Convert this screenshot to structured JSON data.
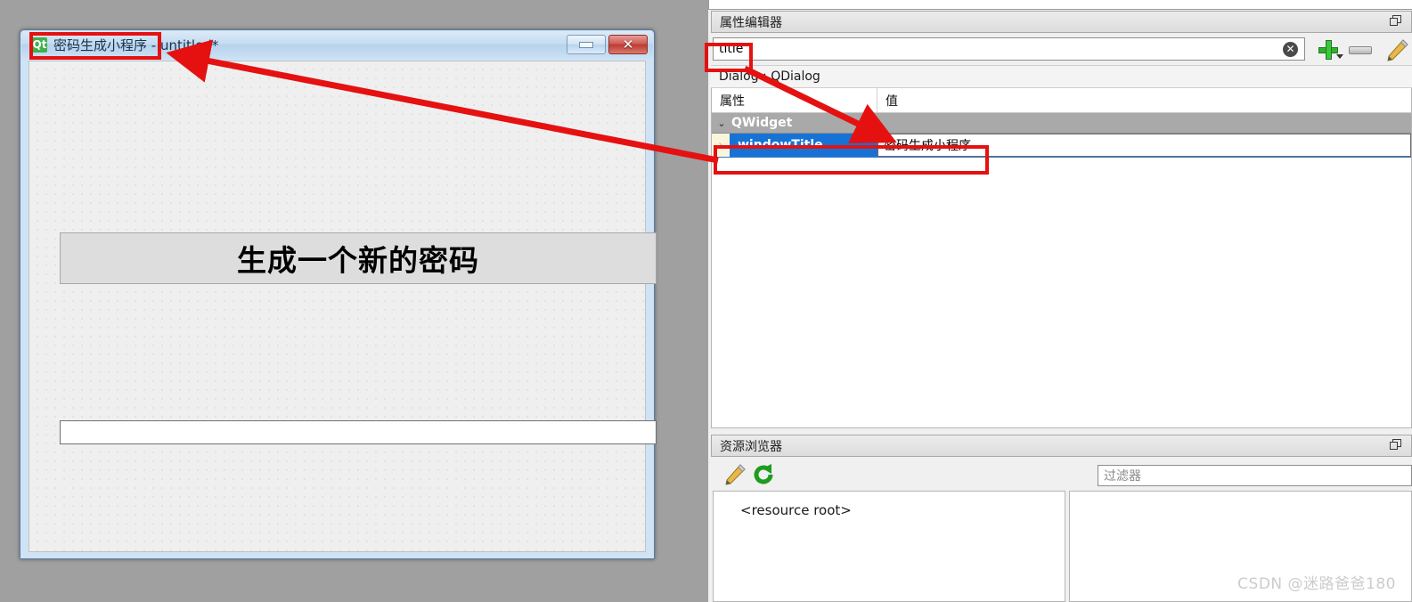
{
  "form_window": {
    "icon": "qt-logo-icon",
    "icon_text": "Qt",
    "title": "密码生成小程序 - untitled*",
    "minimize_label": "",
    "close_label": "✕",
    "button_label": "生成一个新的密码",
    "password_field_value": ""
  },
  "property_editor": {
    "dock_title": "属性编辑器",
    "float_icon": "undock-icon",
    "search": {
      "value": "title",
      "clear_icon": "clear-circle-icon"
    },
    "toolbar": {
      "add_icon": "plus-icon",
      "remove_icon": "minus-icon",
      "configure_icon": "pencil-icon"
    },
    "object_label": "Dialog : QDialog",
    "columns": {
      "name": "属性",
      "value": "值"
    },
    "group": {
      "expand_state": "⌄",
      "name": "QWidget"
    },
    "rows": [
      {
        "expander": "›",
        "name": "windowTitle",
        "value": "密码生成小程序"
      }
    ]
  },
  "resource_browser": {
    "dock_title": "资源浏览器",
    "float_icon": "undock-icon",
    "edit_icon": "pencil-icon",
    "reload_icon": "refresh-icon",
    "filter_placeholder": "过滤器",
    "tree_root": "<resource root>"
  },
  "annotations": {
    "highlight_color": "#e51111",
    "boxes": [
      "title-bar-highlight",
      "search-field-highlight",
      "window-title-row-highlight"
    ],
    "arrows": [
      "arrow-prop-row-to-title-bar",
      "arrow-search-to-value-cell"
    ]
  },
  "watermark": {
    "text": "CSDN @迷路爸爸180"
  }
}
